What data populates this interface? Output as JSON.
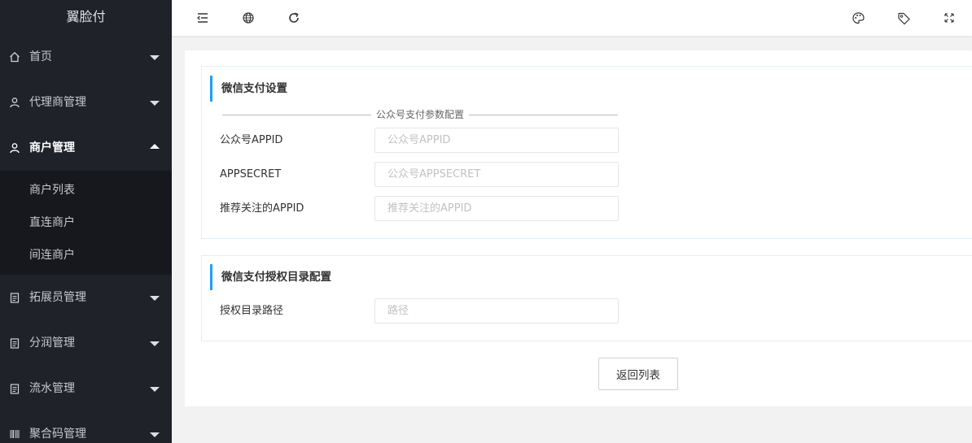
{
  "app": {
    "title": "翼脸付"
  },
  "sidebar": {
    "items": [
      {
        "label": "首页",
        "icon": "home-icon"
      },
      {
        "label": "代理商管理",
        "icon": "user-icon"
      },
      {
        "label": "商户管理",
        "icon": "user-icon",
        "open": true,
        "children": [
          {
            "label": "商户列表"
          },
          {
            "label": "直连商户"
          },
          {
            "label": "间连商户"
          }
        ]
      },
      {
        "label": "拓展员管理",
        "icon": "clipboard-icon"
      },
      {
        "label": "分润管理",
        "icon": "clipboard-icon"
      },
      {
        "label": "流水管理",
        "icon": "clipboard-icon"
      },
      {
        "label": "聚合码管理",
        "icon": "barcode-icon"
      }
    ]
  },
  "header": {
    "left_icons": [
      "menu-fold-icon",
      "globe-icon",
      "refresh-icon"
    ],
    "right_icons": [
      "palette-icon",
      "tag-icon",
      "fullscreen-icon"
    ]
  },
  "wechat_pay": {
    "title": "微信支付设置",
    "legend": "公众号支付参数配置",
    "fields": [
      {
        "label": "公众号APPID",
        "placeholder": "公众号APPID",
        "value": ""
      },
      {
        "label": "APPSECRET",
        "placeholder": "公众号APPSECRET",
        "value": ""
      },
      {
        "label": "推荐关注的APPID",
        "placeholder": "推荐关注的APPID",
        "value": ""
      }
    ]
  },
  "auth_dir": {
    "title": "微信支付授权目录配置",
    "fields": [
      {
        "label": "授权目录路径",
        "placeholder": "路径",
        "value": ""
      }
    ]
  },
  "actions": {
    "back_label": "返回列表"
  },
  "colors": {
    "sidebar_bg": "#20222a",
    "submenu_bg": "#16181d",
    "accent": "#1e9fff",
    "page_bg": "#f2f2f2"
  }
}
